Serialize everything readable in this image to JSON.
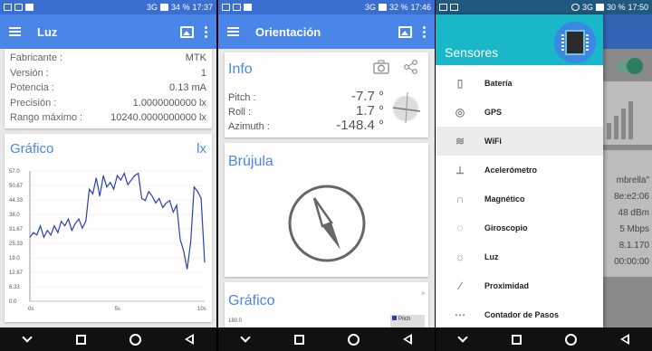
{
  "screen1": {
    "status": {
      "signal": "3G",
      "battery": "34 %",
      "time": "17:37"
    },
    "appbar": {
      "title": "Luz"
    },
    "info": [
      {
        "k": "Fabricante :",
        "v": "MTK"
      },
      {
        "k": "Versión :",
        "v": "1"
      },
      {
        "k": "Potencia :",
        "v": "0.13 mA"
      },
      {
        "k": "Precisión :",
        "v": "1.0000000000 lx"
      },
      {
        "k": "Rango máximo :",
        "v": "10240.0000000000 lx"
      }
    ],
    "chart_title": "Gráfico",
    "chart_unit": "lx",
    "chart_data": {
      "type": "line",
      "title": "Gráfico",
      "ylabel": "lx",
      "ylim": [
        0,
        57
      ],
      "y_ticks": [
        "57.0",
        "50.67",
        "44.33",
        "38.0",
        "31.67",
        "25.33",
        "19.0",
        "12.67",
        "6.33",
        "0.0"
      ],
      "x_ticks": [
        "0s",
        "5s",
        "10s"
      ],
      "xlim": [
        0,
        10
      ],
      "series": [
        {
          "color": "#2b3fb0",
          "x": [
            0,
            0.2,
            0.4,
            0.6,
            0.8,
            1.0,
            1.2,
            1.4,
            1.6,
            1.8,
            2.0,
            2.2,
            2.4,
            2.6,
            2.8,
            3.0,
            3.2,
            3.4,
            3.6,
            3.8,
            4.0,
            4.2,
            4.4,
            4.6,
            4.8,
            5.0,
            5.2,
            5.4,
            5.6,
            5.8,
            6.0,
            6.2,
            6.4,
            6.6,
            6.8,
            7.0,
            7.2,
            7.4,
            7.6,
            7.8,
            8.0,
            8.2,
            8.4,
            8.6,
            8.8,
            9.0,
            9.2,
            9.4,
            9.6,
            9.8,
            10.0
          ],
          "values": [
            28,
            30,
            29,
            33,
            28,
            31,
            29,
            33,
            30,
            35,
            33,
            36,
            31,
            34,
            36,
            32,
            35,
            49,
            47,
            54,
            46,
            55,
            50,
            52,
            49,
            55,
            53,
            56,
            51,
            53,
            55,
            56,
            45,
            44,
            48,
            46,
            43,
            45,
            41,
            43,
            44,
            39,
            42,
            27,
            22,
            14,
            26,
            50,
            48,
            45,
            17
          ]
        }
      ]
    }
  },
  "screen2": {
    "status": {
      "signal": "3G",
      "battery": "32 %",
      "time": "17:46"
    },
    "appbar": {
      "title": "Orientación"
    },
    "info_title": "Info",
    "rows": [
      {
        "k": "Pitch :",
        "v": "-7.7 °"
      },
      {
        "k": "Roll :",
        "v": "1.7 °"
      },
      {
        "k": "Azimuth :",
        "v": "-148.4 °"
      }
    ],
    "compass_title": "Brújula",
    "graph_title": "Gráfico",
    "graph_top_tick": "180.0",
    "legend_pitch": "Pitch"
  },
  "screen3": {
    "status": {
      "signal": "3G",
      "battery": "30 %",
      "time": "17:50"
    },
    "drawer_title": "Sensores",
    "menu": [
      "Batería",
      "GPS",
      "WiFi",
      "Acelerómetro",
      "Magnético",
      "Giroscopio",
      "Luz",
      "Proximidad",
      "Contador de Pasos"
    ],
    "behind_lines": [
      "mbrella\"",
      "8e:e2:06",
      "48 dBm",
      "5 Mbps",
      "8.1.170",
      "00:00:00"
    ]
  },
  "colors": {
    "appbar": "#4a86e8",
    "statusbar": "#3a6fd1",
    "accent": "#4a86e8",
    "drawer": "#1ab7c9",
    "line": "#2b3fb0"
  }
}
